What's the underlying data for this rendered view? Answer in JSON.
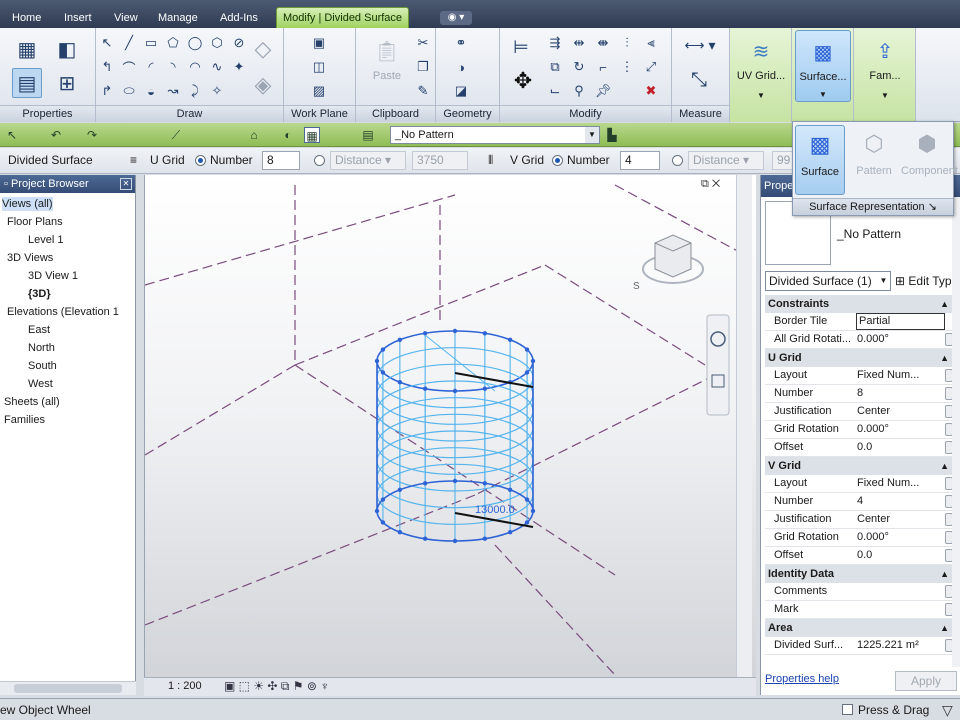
{
  "tabs": [
    {
      "label": "Home",
      "x": 0
    },
    {
      "label": "Insert"
    },
    {
      "label": "View"
    },
    {
      "label": "Manage"
    },
    {
      "label": "Add-Ins"
    },
    {
      "label": "Modify | Divided Surface"
    }
  ],
  "panels": {
    "properties": "Properties",
    "draw": "Draw",
    "work_plane": "Work Plane",
    "clipboard": "Clipboard",
    "paste": "Paste",
    "geometry": "Geometry",
    "modify": "Modify",
    "measure": "Measure",
    "uv_grid": "UV Grid...",
    "surface": "Surface...",
    "family": "Fam..."
  },
  "quickbar": {
    "pattern_value": "_No Pattern"
  },
  "options": {
    "context": "Divided Surface",
    "u_grid_label": "U Grid",
    "u_number_label": "Number",
    "u_number": "8",
    "u_distance_label": "Distance",
    "u_distance": "3750",
    "v_grid_label": "V Grid",
    "v_number_label": "Number",
    "v_number": "4",
    "v_distance_label": "Distance",
    "v_distance": "99"
  },
  "flyout": {
    "surface": "Surface",
    "pattern": "Pattern",
    "component": "Component",
    "caption": "Surface Representation"
  },
  "browser": {
    "title": "Project Browser",
    "items": [
      "Views (all)",
      "Floor Plans",
      "Level 1",
      "3D Views",
      "3D View 1",
      "{3D}",
      "Elevations (Elevation 1",
      "East",
      "North",
      "South",
      "West",
      "Sheets (all)",
      "Families"
    ]
  },
  "viewport": {
    "scale": "1 : 200",
    "dimension": "13000.0",
    "viewcube_face": "S"
  },
  "properties": {
    "title": "Prope",
    "type_name": "_No Pattern",
    "selector": "Divided Surface (1)",
    "edit_type": "Edit Typ",
    "groups": [
      {
        "name": "Constraints",
        "rows": [
          {
            "k": "Border Tile",
            "v": "Partial"
          },
          {
            "k": "All Grid Rotati...",
            "v": "0.000°"
          }
        ]
      },
      {
        "name": "U Grid",
        "rows": [
          {
            "k": "Layout",
            "v": "Fixed Num..."
          },
          {
            "k": "Number",
            "v": "8"
          },
          {
            "k": "Justification",
            "v": "Center"
          },
          {
            "k": "Grid Rotation",
            "v": "0.000°"
          },
          {
            "k": "Offset",
            "v": "0.0"
          }
        ]
      },
      {
        "name": "V Grid",
        "rows": [
          {
            "k": "Layout",
            "v": "Fixed Num..."
          },
          {
            "k": "Number",
            "v": "4"
          },
          {
            "k": "Justification",
            "v": "Center"
          },
          {
            "k": "Grid Rotation",
            "v": "0.000°"
          },
          {
            "k": "Offset",
            "v": "0.0"
          }
        ]
      },
      {
        "name": "Identity Data",
        "rows": [
          {
            "k": "Comments",
            "v": ""
          },
          {
            "k": "Mark",
            "v": ""
          }
        ]
      },
      {
        "name": "Area",
        "rows": [
          {
            "k": "Divided Surf...",
            "v": "1225.221 m²"
          }
        ]
      }
    ],
    "help": "Properties help",
    "apply": "Apply"
  },
  "status": {
    "message": "ew Object Wheel",
    "press_drag": "Press & Drag"
  },
  "colors": {
    "wire": "#2d63d6",
    "wire_light": "#55b4ee",
    "ref_line": "#7a4b7e"
  }
}
